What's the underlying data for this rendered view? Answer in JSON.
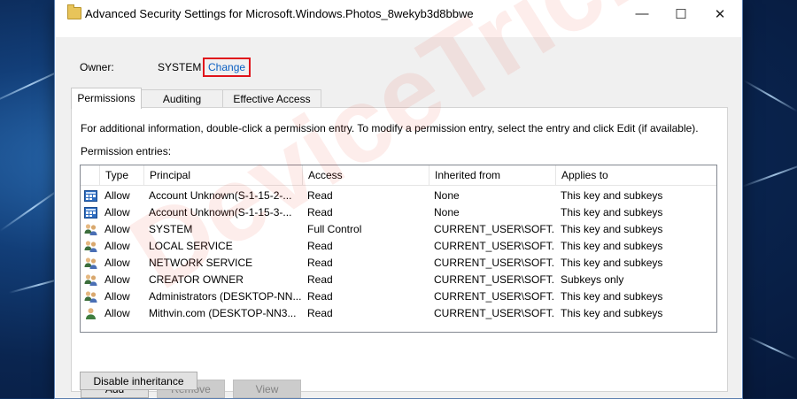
{
  "window": {
    "title": "Advanced Security Settings for Microsoft.Windows.Photos_8wekyb3d8bbwe",
    "controls": {
      "minimize": "—",
      "maximize": "☐",
      "close": "✕"
    }
  },
  "owner": {
    "label": "Owner:",
    "value": "SYSTEM",
    "change_link": "Change",
    "highlight_color": "#e0141b"
  },
  "tabs": [
    {
      "label": "Permissions",
      "active": true
    },
    {
      "label": "Auditing",
      "active": false
    },
    {
      "label": "Effective Access",
      "active": false
    }
  ],
  "permissions": {
    "info_text": "For additional information, double-click a permission entry. To modify a permission entry, select the entry and click Edit (if available).",
    "entries_label": "Permission entries:",
    "columns": [
      "Type",
      "Principal",
      "Access",
      "Inherited from",
      "Applies to"
    ],
    "rows": [
      {
        "icon": "app-package-icon",
        "type": "Allow",
        "principal": "Account Unknown(S-1-15-2-...",
        "access": "Read",
        "inherited": "None",
        "applies": "This key and subkeys"
      },
      {
        "icon": "app-package-icon",
        "type": "Allow",
        "principal": "Account Unknown(S-1-15-3-...",
        "access": "Read",
        "inherited": "None",
        "applies": "This key and subkeys"
      },
      {
        "icon": "users-group-icon",
        "type": "Allow",
        "principal": "SYSTEM",
        "access": "Full Control",
        "inherited": "CURRENT_USER\\SOFT...",
        "applies": "This key and subkeys"
      },
      {
        "icon": "users-group-icon",
        "type": "Allow",
        "principal": "LOCAL SERVICE",
        "access": "Read",
        "inherited": "CURRENT_USER\\SOFT...",
        "applies": "This key and subkeys"
      },
      {
        "icon": "users-group-icon",
        "type": "Allow",
        "principal": "NETWORK SERVICE",
        "access": "Read",
        "inherited": "CURRENT_USER\\SOFT...",
        "applies": "This key and subkeys"
      },
      {
        "icon": "users-group-icon",
        "type": "Allow",
        "principal": "CREATOR OWNER",
        "access": "Read",
        "inherited": "CURRENT_USER\\SOFT...",
        "applies": "Subkeys only"
      },
      {
        "icon": "users-group-icon",
        "type": "Allow",
        "principal": "Administrators (DESKTOP-NN...",
        "access": "Read",
        "inherited": "CURRENT_USER\\SOFT...",
        "applies": "This key and subkeys"
      },
      {
        "icon": "user-icon",
        "type": "Allow",
        "principal": "Mithvin.com (DESKTOP-NN3...",
        "access": "Read",
        "inherited": "CURRENT_USER\\SOFT...",
        "applies": "This key and subkeys"
      }
    ]
  },
  "buttons": {
    "add": "Add",
    "remove": "Remove",
    "view": "View",
    "disable_inheritance": "Disable inheritance"
  },
  "watermark": {
    "text": "DeviceTricks"
  }
}
